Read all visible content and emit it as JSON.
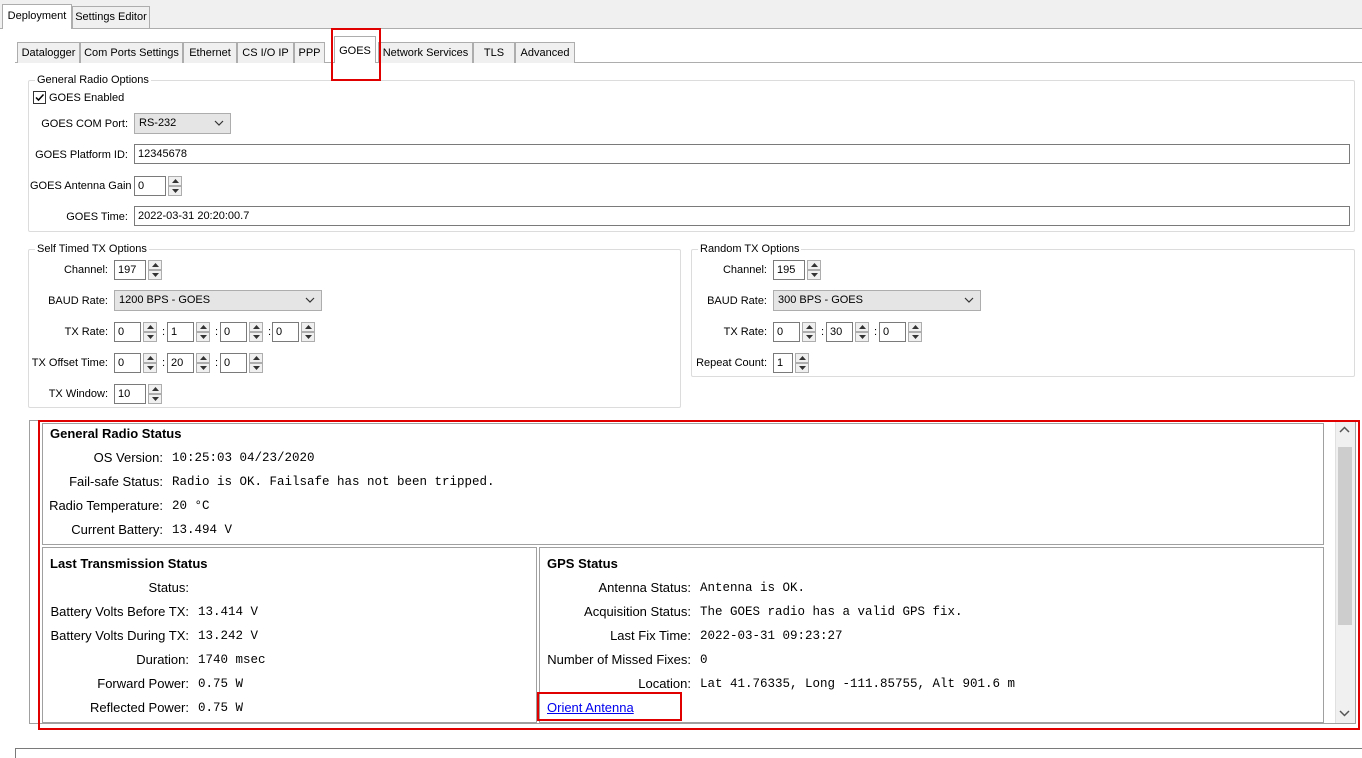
{
  "top_tabs": [
    {
      "label": "Deployment",
      "active": true
    },
    {
      "label": "Settings Editor",
      "active": false
    }
  ],
  "sub_tabs": [
    {
      "label": "Datalogger"
    },
    {
      "label": "Com Ports Settings"
    },
    {
      "label": "Ethernet"
    },
    {
      "label": "CS I/O IP"
    },
    {
      "label": "PPP"
    },
    {
      "label": "GOES",
      "active": true
    },
    {
      "label": "Network Services"
    },
    {
      "label": "TLS"
    },
    {
      "label": "Advanced"
    }
  ],
  "general_radio_options": {
    "legend": "General Radio Options",
    "goes_enabled_label": "GOES Enabled",
    "goes_enabled": true,
    "com_port_label": "GOES COM Port:",
    "com_port_value": "RS-232",
    "platform_id_label": "GOES Platform ID:",
    "platform_id_value": "12345678",
    "antenna_gain_label": "GOES Antenna Gain",
    "antenna_gain_value": "0",
    "time_label": "GOES Time:",
    "time_value": "2022-03-31 20:20:00.7"
  },
  "self_timed": {
    "legend": "Self Timed TX Options",
    "channel_label": "Channel:",
    "channel_value": "197",
    "baud_label": "BAUD Rate:",
    "baud_value": "1200 BPS - GOES",
    "tx_rate_label": "TX Rate:",
    "tx_rate_values": [
      "0",
      "1",
      "0",
      "0"
    ],
    "tx_offset_label": "TX Offset Time:",
    "tx_offset_values": [
      "0",
      "20",
      "0"
    ],
    "tx_window_label": "TX Window:",
    "tx_window_value": "10",
    "separator": ":"
  },
  "random_tx": {
    "legend": "Random TX Options",
    "channel_label": "Channel:",
    "channel_value": "195",
    "baud_label": "BAUD Rate:",
    "baud_value": "300 BPS - GOES",
    "tx_rate_label": "TX Rate:",
    "tx_rate_values": [
      "0",
      "30",
      "0"
    ],
    "repeat_label": "Repeat Count:",
    "repeat_value": "1",
    "separator": ":"
  },
  "general_status": {
    "title": "General Radio Status",
    "rows": [
      {
        "label": "OS Version:",
        "value": "10:25:03 04/23/2020"
      },
      {
        "label": "Fail-safe Status:",
        "value": "Radio is OK. Failsafe has not been tripped."
      },
      {
        "label": "Radio Temperature:",
        "value": "20 °C"
      },
      {
        "label": "Current Battery:",
        "value": "13.494 V"
      }
    ]
  },
  "last_tx_status": {
    "title": "Last Transmission Status",
    "rows": [
      {
        "label": "Status:",
        "value": ""
      },
      {
        "label": "Battery Volts Before TX:",
        "value": "13.414 V"
      },
      {
        "label": "Battery Volts During TX:",
        "value": "13.242 V"
      },
      {
        "label": "Duration:",
        "value": "1740 msec"
      },
      {
        "label": "Forward Power:",
        "value": "0.75 W"
      },
      {
        "label": "Reflected Power:",
        "value": "0.75 W"
      }
    ]
  },
  "gps_status": {
    "title": "GPS Status",
    "rows": [
      {
        "label": "Antenna Status:",
        "value": "Antenna is OK."
      },
      {
        "label": "Acquisition Status:",
        "value": "The GOES radio has a valid GPS fix."
      },
      {
        "label": "Last Fix Time:",
        "value": "2022-03-31 09:23:27"
      },
      {
        "label": "Number of Missed Fixes:",
        "value": "0"
      },
      {
        "label": "Location:",
        "value": "Lat 41.76335, Long -111.85755, Alt 901.6 m"
      }
    ],
    "orient_link": "Orient Antenna"
  },
  "colors": {
    "highlight": "#e00000",
    "link": "#0000ee",
    "tab_bg": "#f0f0f0",
    "border": "#adadad"
  }
}
